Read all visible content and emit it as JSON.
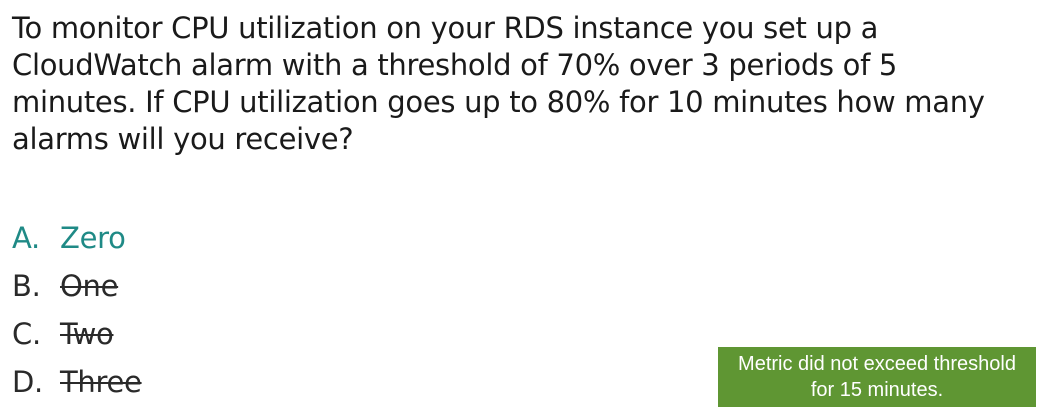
{
  "question": {
    "text": "To monitor CPU utilization on your RDS instance you set up a CloudWatch alarm with a threshold of 70% over 3 periods of 5 minutes. If CPU utilization goes up to 80% for 10 minutes how many alarms will you receive?"
  },
  "answers": [
    {
      "letter": "A.",
      "text": "Zero",
      "state": "correct"
    },
    {
      "letter": "B.",
      "text": "One",
      "state": "eliminated"
    },
    {
      "letter": "C.",
      "text": "Two",
      "state": "eliminated"
    },
    {
      "letter": "D.",
      "text": "Three",
      "state": "eliminated"
    }
  ],
  "feedback": {
    "line1": "Metric did not exceed threshold",
    "line2": "for 15 minutes."
  },
  "colors": {
    "correct": "#1f8a86",
    "feedback_bg": "#5f9633"
  }
}
